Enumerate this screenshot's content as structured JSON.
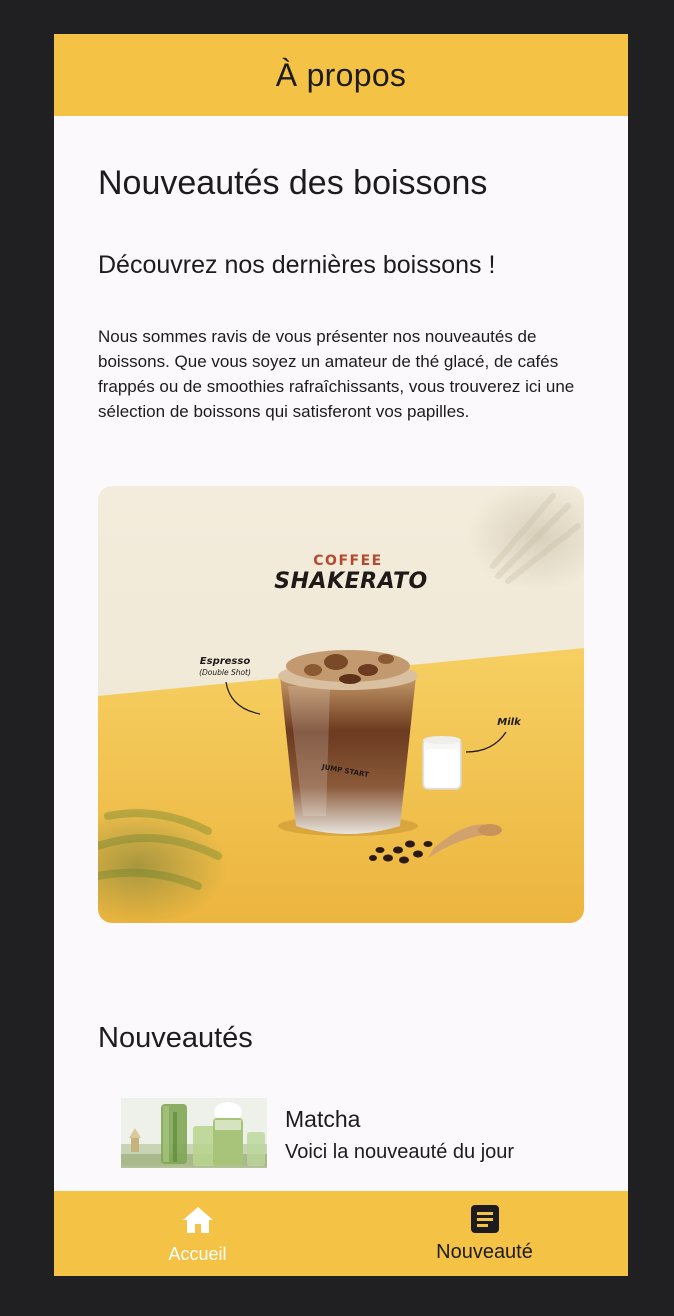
{
  "appbar": {
    "title": "À propos"
  },
  "main": {
    "title": "Nouveautés des boissons",
    "subtitle": "Découvrez nos dernières boissons !",
    "intro": "Nous sommes ravis de vous présenter nos nouveautés de boissons. Que vous soyez un amateur de thé glacé, de cafés frappés ou de smoothies rafraîchissants, vous trouverez ici une sélection de boissons qui satisferont vos papilles.",
    "hero": {
      "brand_top": "COFFEE",
      "brand_main": "SHAKERATO",
      "label_espresso": "Espresso",
      "label_espresso_sub": "(Double Shot)",
      "label_milk": "Milk",
      "cup_text": "JUMP START"
    },
    "section_title": "Nouveautés",
    "items": [
      {
        "title": "Matcha",
        "subtitle": "Voici la nouveauté du jour"
      }
    ]
  },
  "bottom_nav": {
    "items": [
      {
        "label": "Accueil",
        "icon": "home-icon",
        "selected": false
      },
      {
        "label": "Nouveauté",
        "icon": "article-icon",
        "selected": true
      }
    ]
  },
  "colors": {
    "accent": "#f4c244",
    "background": "#fcf9fc",
    "text": "#1d1b1e",
    "frame": "#202022"
  }
}
